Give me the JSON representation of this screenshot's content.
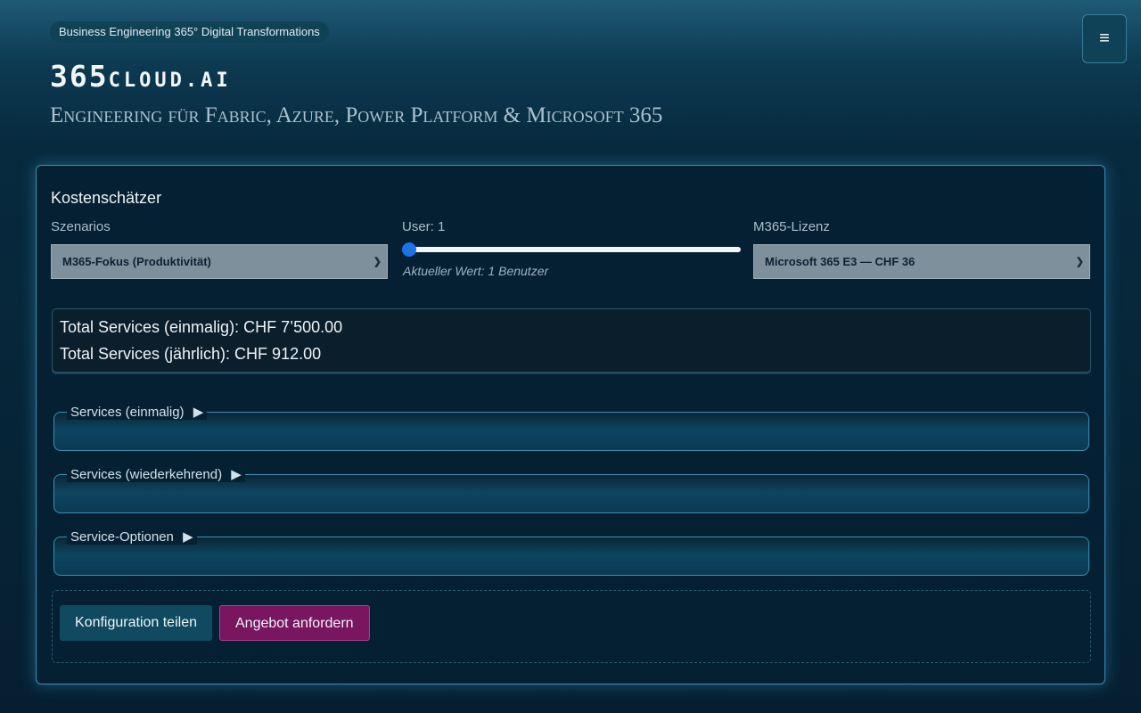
{
  "header": {
    "badge": "Business Engineering 365° Digital Transformations",
    "brand_main": "365",
    "brand_suffix": "cloud.ai",
    "subtitle": "Engineering für Fabric, Azure, Power Platform & Microsoft 365",
    "menu_icon": "hamburger-icon"
  },
  "estimator": {
    "title": "Kostenschätzer",
    "scenario": {
      "label": "Szenarios",
      "value": "M365-Fokus (Produktivität)"
    },
    "users": {
      "label": "User: 1",
      "value": 1,
      "note": "Aktueller Wert: 1 Benutzer"
    },
    "license": {
      "label": "M365-Lizenz",
      "value": "Microsoft 365 E3 — CHF 36"
    },
    "totals": {
      "one_time": "Total Services (einmalig): CHF 7’500.00",
      "annual": "Total Services (jährlich): CHF 912.00"
    },
    "sections": [
      {
        "label": "Services (einmalig)",
        "icon": "▶"
      },
      {
        "label": "Services (wiederkehrend)",
        "icon": "▶"
      },
      {
        "label": "Service-Optionen",
        "icon": "▶"
      }
    ],
    "actions": {
      "share_label": "Konfiguration teilen",
      "offer_label": "Angebot anfordern"
    }
  },
  "colors": {
    "accent": "#3a90b4",
    "primary_button": "#0f4a60",
    "cta_button": "#7a1560",
    "slider_thumb": "#1a73e8"
  }
}
